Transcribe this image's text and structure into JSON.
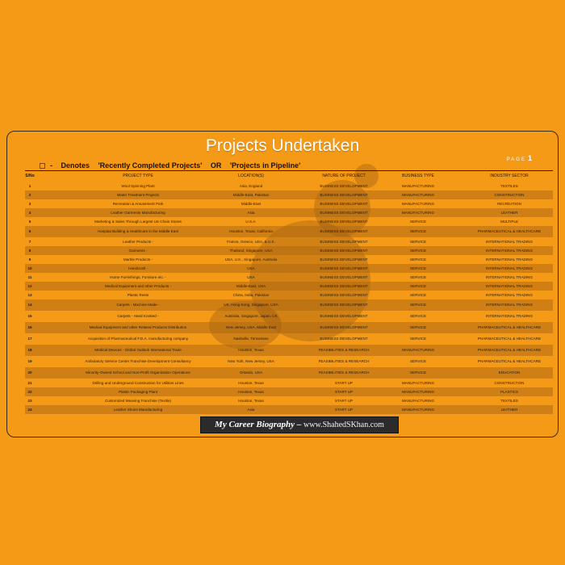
{
  "title": "Projects Undertaken",
  "page": {
    "label": "PAGE",
    "number": "1"
  },
  "legend": {
    "denotes": "Denotes",
    "completed": "'Recently Completed Projects'",
    "or": "OR",
    "pipeline": "'Projects in Pipeline'"
  },
  "table": {
    "headers": [
      "S/No",
      "PROJECT TYPE",
      "LOCATION(S)",
      "NATURE OF PROJECT",
      "BUSINESS TYPE",
      "INDUSTRY SECTOR"
    ],
    "rows": [
      [
        "1",
        "Wool Spinning Plant",
        "Asia, England",
        "BUSINESS DEVELOPMENT",
        "MANUFACTURING",
        "TEXTILES"
      ],
      [
        "2",
        "Water Treatment Projects",
        "Middle-East, Pakistan",
        "BUSINESS DEVELOPMENT",
        "MANUFACTURING",
        "CONSTRUCTION"
      ],
      [
        "3",
        "Recreation & Amusement Park",
        "Middle-East",
        "BUSINESS DEVELOPMENT",
        "MANUFACTURING",
        "RECREATION"
      ],
      [
        "4",
        "Leather Garments Manufacturing",
        "Asia",
        "BUSINESS DEVELOPMENT",
        "MANUFACTURING",
        "LEATHER"
      ],
      [
        "5",
        "Marketing & Sales Through Largest US Chain Stores",
        "U.S.A.",
        "BUSINESS DEVELOPMENT",
        "SERVICE",
        "MULTIPLE"
      ],
      [
        "6",
        "Hospital Building & Healthcare in the Middle East",
        "Houston, Texas, California",
        "BUSINESS DEVELOPMENT",
        "SERVICE",
        "PHARMACEUTICAL & HEALTHCARE"
      ],
      [
        "7",
        "Leather Products -",
        "France, Greece, USA, & U.K.",
        "BUSINESS DEVELOPMENT",
        "SERVICE",
        "INTERNATIONAL TRADING"
      ],
      [
        "8",
        "Garments -",
        "Thailand, Singapore, USA",
        "BUSINESS DEVELOPMENT",
        "SERVICE",
        "INTERNATIONAL TRADING"
      ],
      [
        "9",
        "Marble Products -",
        "USA, U.K., Singapore, Australia",
        "BUSINESS DEVELOPMENT",
        "SERVICE",
        "INTERNATIONAL TRADING"
      ],
      [
        "10",
        "Handicraft -",
        "USA",
        "BUSINESS DEVELOPMENT",
        "SERVICE",
        "INTERNATIONAL TRADING"
      ],
      [
        "11",
        "Home Furnishings, Furniture etc. -",
        "USA",
        "BUSINESS DEVELOPMENT",
        "SERVICE",
        "INTERNATIONAL TRADING"
      ],
      [
        "12",
        "Medical Equipment and other Products -",
        "Middle-East, USA",
        "BUSINESS DEVELOPMENT",
        "SERVICE",
        "INTERNATIONAL TRADING"
      ],
      [
        "13",
        "Plastic Resin",
        "China, India, Pakistan",
        "BUSINESS DEVELOPMENT",
        "SERVICE",
        "INTERNATIONAL TRADING"
      ],
      [
        "14",
        "Carpets - Machine Made -",
        "UK, Hong Kong, Singapore, USA",
        "BUSINESS DEVELOPMENT",
        "SERVICE",
        "INTERNATIONAL TRADING"
      ],
      [
        "15",
        "Carpets - Hand Knotted -",
        "Australia, Singapore, Japan, UK",
        "BUSINESS DEVELOPMENT",
        "SERVICE",
        "INTERNATIONAL TRADING"
      ],
      [
        "16",
        "Medical Equipment and other Related Products Distribution",
        "New Jersey, USA, Middle East",
        "BUSINESS DEVELOPMENT",
        "SERVICE",
        "PHARMACEUTICAL & HEALTHCARE"
      ],
      [
        "17",
        "Acquisition of Pharmaceutical F.D.A. manufacturing company",
        "Nashville, Tennessee",
        "BUSINESS DEVELOPMENT",
        "SERVICE",
        "PHARMACEUTICAL & HEALTHCARE"
      ],
      [
        "18",
        "Medical Devices - Global Outlook International Trade",
        "Houston, Texas",
        "FEASIBILITIES & RESEARCH",
        "MANUFACTURING",
        "PHARMACEUTICAL & HEALTHCARE"
      ],
      [
        "19",
        "Ambulatory Service Center Franchise Development Consultancy",
        "New York, New Jersey, USA",
        "FEASIBILITIES & RESEARCH",
        "SERVICE",
        "PHARMACEUTICAL & HEALTHCARE"
      ],
      [
        "20",
        "Minority-Owned School and Non-Profit Organization Operations",
        "Orlando, USA",
        "FEASIBILITIES & RESEARCH",
        "SERVICE",
        "EDUCATION"
      ],
      [
        "21",
        "Drilling and Underground Construction for Utilities Lines",
        "Houston, Texas",
        "START UP",
        "MANUFACTURING",
        "CONSTRUCTION"
      ],
      [
        "22",
        "Plastic Packaging Plant",
        "Houston, Texas",
        "START UP",
        "MANUFACTURING",
        "PLASTICS"
      ],
      [
        "23",
        "Customized Weaving Franchise (Textile)",
        "Houston, Texas",
        "START UP",
        "MANUFACTURING",
        "TEXTILES"
      ],
      [
        "24",
        "Leather Shoes Manufacturing",
        "Asia",
        "START UP",
        "MANUFACTURING",
        "LEATHER"
      ]
    ]
  },
  "banner": {
    "text": "My Career Biography –",
    "url": "www.ShahedSKhan.com"
  }
}
